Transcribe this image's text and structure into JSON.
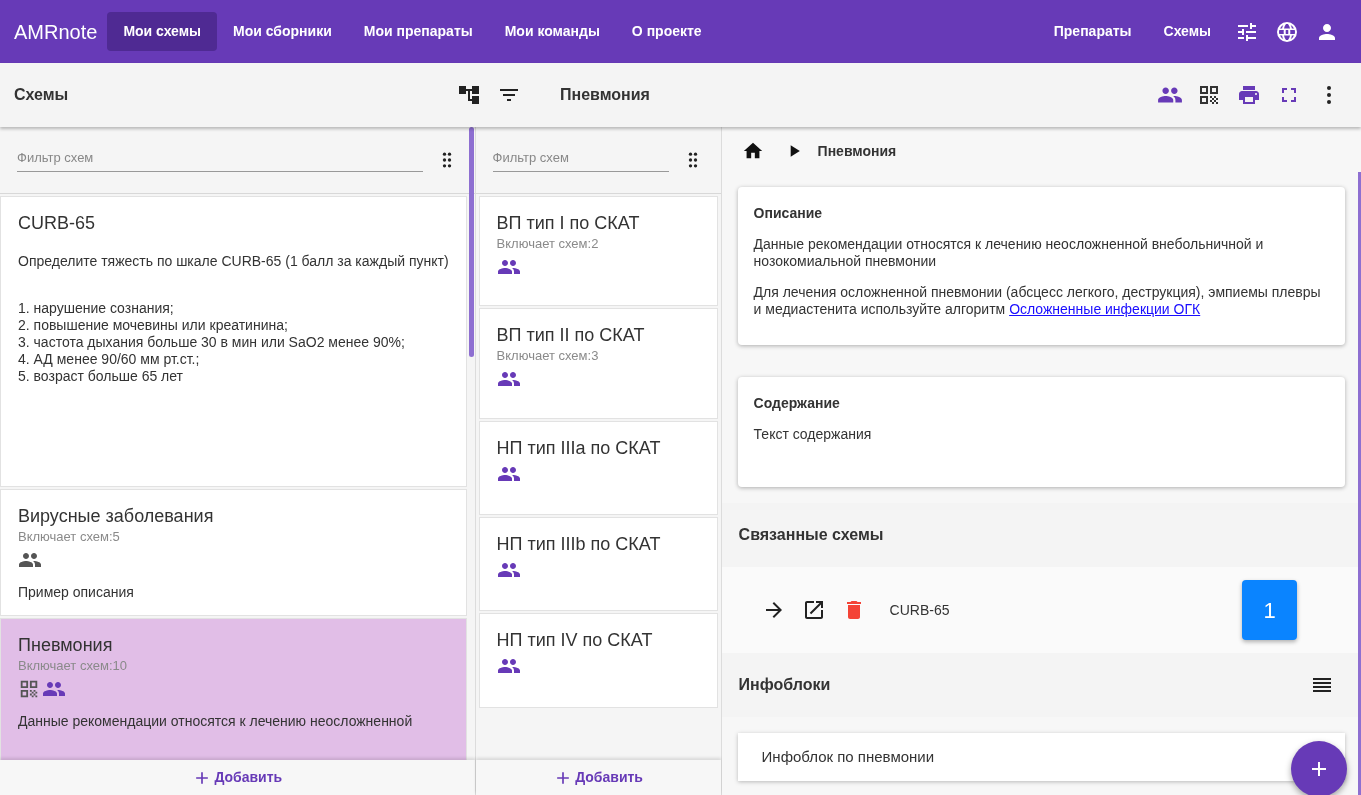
{
  "nav": {
    "brand": "AMRnote",
    "items": [
      {
        "label": "Мои схемы",
        "selected": true
      },
      {
        "label": "Мои сборники",
        "selected": false
      },
      {
        "label": "Мои препараты",
        "selected": false
      },
      {
        "label": "Мои команды",
        "selected": false
      },
      {
        "label": "О проекте",
        "selected": false
      }
    ],
    "right_links": [
      "Препараты",
      "Схемы"
    ]
  },
  "toolbar": {
    "left_title": "Схемы",
    "right_title": "Пневмония"
  },
  "columns": [
    {
      "filter_placeholder": "Фильтр схем",
      "add_label": "Добавить",
      "schemes": [
        {
          "title": "CURB-65",
          "selected": false,
          "description": [
            [
              "Определите тяжесть по шкале CURB-65 (1 балл за каждый пункт)"
            ],
            [
              "1. нарушение сознания;",
              "2. повышение мочевины или креатинина;",
              "3. частота дыхания больше 30 в мин или SaO2 менее 90%;",
              "4. АД менее 90/60 мм рт.ст.;",
              "5. возраст больше 65 лет"
            ]
          ]
        },
        {
          "title": "Вирусные заболевания",
          "count": "Включает схем:5",
          "selected": false,
          "icons": [
            {
              "kind": "group",
              "highlighted": false
            }
          ],
          "description": [
            [
              "Пример описания"
            ]
          ]
        },
        {
          "title": "Пневмония",
          "count": "Включает схем:10",
          "selected": true,
          "icons": [
            {
              "kind": "qr",
              "highlighted": false
            },
            {
              "kind": "group",
              "highlighted": true
            }
          ],
          "description": [
            [
              "Данные рекомендации относятся к лечению неосложненной"
            ]
          ]
        }
      ]
    },
    {
      "filter_placeholder": "Фильтр схем",
      "add_label": "Добавить",
      "schemes": [
        {
          "title": "ВП тип I по СКАТ",
          "count": "Включает схем:2",
          "selected": false,
          "icons": [
            {
              "kind": "group",
              "highlighted": true
            }
          ]
        },
        {
          "title": "ВП тип II по СКАТ",
          "count": "Включает схем:3",
          "selected": false,
          "icons": [
            {
              "kind": "group",
              "highlighted": true
            }
          ]
        },
        {
          "title": "НП тип IIIa по СКАТ",
          "selected": false,
          "icons": [
            {
              "kind": "group",
              "highlighted": true
            }
          ]
        },
        {
          "title": "НП тип IIIb по СКАТ",
          "selected": false,
          "icons": [
            {
              "kind": "group",
              "highlighted": true
            }
          ]
        },
        {
          "title": "НП тип IV по СКАТ",
          "selected": false,
          "icons": [
            {
              "kind": "group",
              "highlighted": true
            }
          ]
        }
      ]
    }
  ],
  "breadcrumb": [
    "Пневмония"
  ],
  "cards": [
    {
      "title": "Описание",
      "paragraphs": [
        {
          "text": "Данные рекомендации относятся к лечению неосложненной внебольничной и нозокомиальной пневмонии"
        },
        {
          "text": "Для лечения осложненной пневмонии (абсцесс легкого, деструкция), эмпиемы плевры и медиастенита используйте алгоритм",
          "link": "Осложненные инфекции ОГК"
        }
      ]
    },
    {
      "title": "Содержание",
      "paragraphs": [
        {
          "text": "Текст содержания"
        }
      ]
    }
  ],
  "related": {
    "title": "Связанные схемы",
    "items": [
      {
        "name": "CURB-65",
        "badge": "1"
      }
    ]
  },
  "infoblocks": {
    "title": "Инфоблоки",
    "items": [
      "Инфоблок по пневмонии"
    ]
  }
}
